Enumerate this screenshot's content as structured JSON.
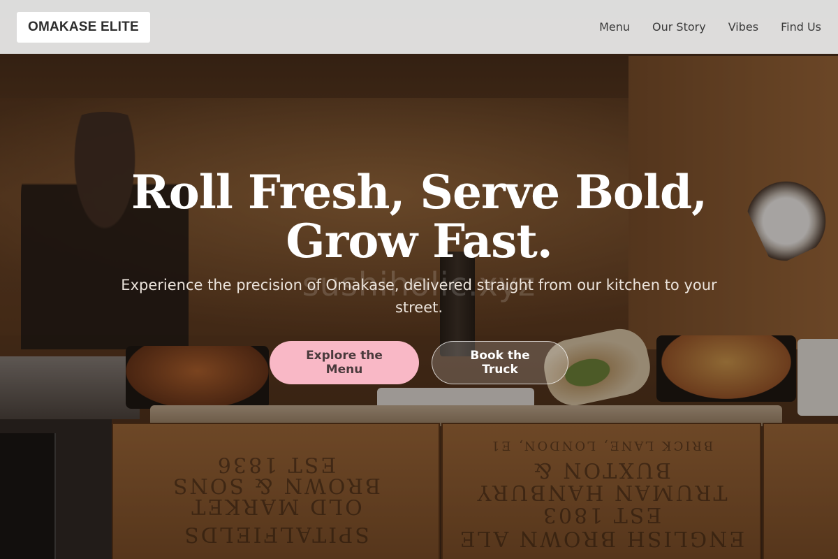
{
  "header": {
    "brand": "OMAKASE ELITE",
    "nav": [
      {
        "label": "Menu"
      },
      {
        "label": "Our Story"
      },
      {
        "label": "Vibes"
      },
      {
        "label": "Find Us"
      }
    ]
  },
  "hero": {
    "title_line1": "Roll Fresh, Serve Bold,",
    "title_line2": "Grow Fast.",
    "watermark": "sushiholic.xyz",
    "subtitle": "Experience the precision of Omakase, delivered straight from our kitchen to your street.",
    "primary_cta": "Explore the Menu",
    "secondary_cta": "Book the Truck",
    "crate_text": {
      "left_lines": [
        "EST 1836",
        "BROWN & SONS",
        "OLD MARKET",
        "SPITALFIELDS"
      ],
      "right_lines": [
        "BRICK LANE, LONDON, E1",
        "BUXTON &",
        "TRUMAN HANBURY",
        "EST 1803",
        "ENGLISH BROWN ALE"
      ]
    }
  },
  "colors": {
    "primary_button": "#f9b8c6",
    "header_bg": "#e4e4e4"
  }
}
